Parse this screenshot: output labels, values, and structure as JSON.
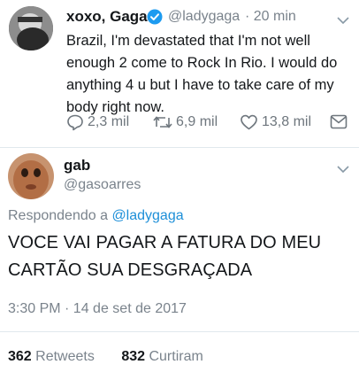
{
  "tweet": {
    "display_name": "xoxo, Gaga",
    "handle": "@ladygaga",
    "time": "· 20 min",
    "lines": [
      "Brazil, I'm devastated that I'm not well",
      "enough 2 come to Rock In Rio. I would do",
      "anything 4 u but I have to take care of my",
      "body right now."
    ],
    "replies": "2,3 mil",
    "retweets": "6,9 mil",
    "likes": "13,8 mil"
  },
  "reply": {
    "display_name": "gab",
    "handle": "@gasoarres",
    "replying_label": "Respondendo a",
    "replying_to": "@ladygaga",
    "lines": [
      "VOCE VAI PAGAR A FATURA DO MEU",
      "CARTÃO SUA DESGRAÇADA"
    ],
    "timestamp": "3:30 PM · 14 de set de 2017",
    "retweet_count": "362",
    "retweet_label": "Retweets",
    "like_count": "832",
    "like_label": "Curtiram"
  },
  "colors": {
    "verified": "#1d9bf0",
    "link": "#1d8fd8",
    "muted": "#7a838c"
  },
  "icons": [
    "verified-icon",
    "reply-icon",
    "retweet-icon",
    "like-icon",
    "dm-icon",
    "chevron-down-icon"
  ]
}
